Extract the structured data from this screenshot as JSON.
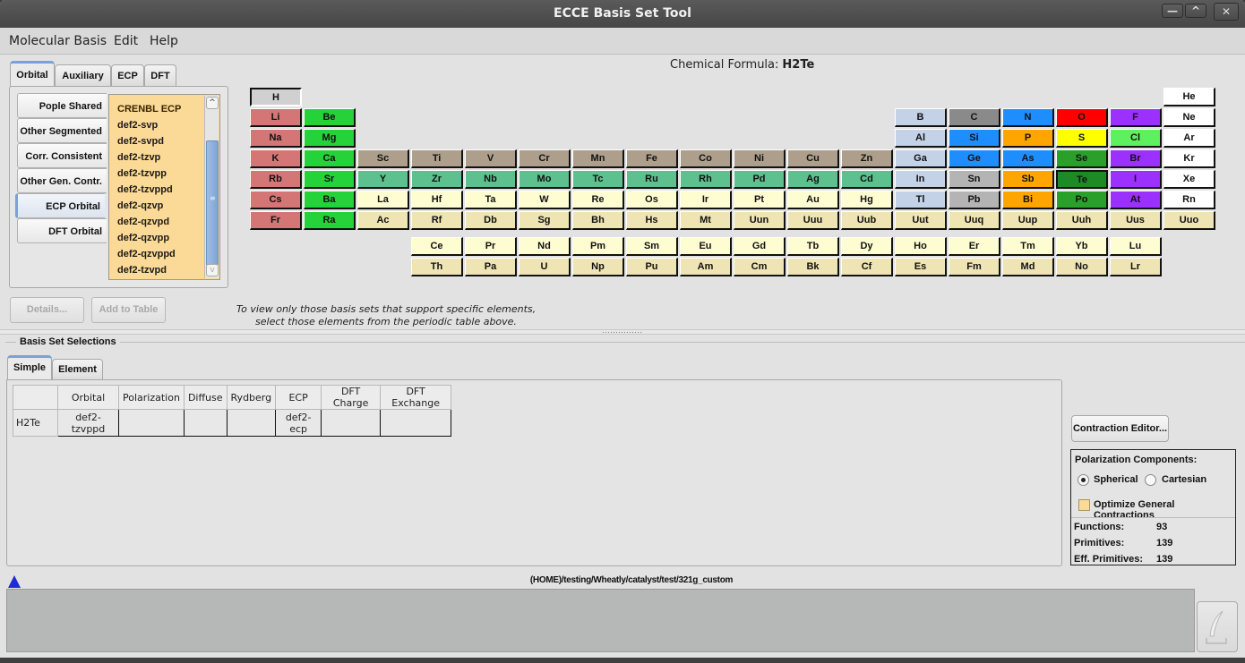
{
  "window": {
    "title": "ECCE Basis Set Tool",
    "controls": {
      "minimize": "—",
      "maximize": "^",
      "close": "✕"
    }
  },
  "menu": [
    "Molecular Basis",
    "Edit",
    "Help"
  ],
  "type_tabs": [
    {
      "label": "Orbital",
      "active": true
    },
    {
      "label": "Auxiliary",
      "active": false
    },
    {
      "label": "ECP",
      "active": false
    },
    {
      "label": "DFT",
      "active": false
    }
  ],
  "categories": [
    {
      "label": "Pople Shared",
      "active": false
    },
    {
      "label": "Other Segmented",
      "active": false
    },
    {
      "label": "Corr. Consistent",
      "active": false
    },
    {
      "label": "Other Gen. Contr.",
      "active": false
    },
    {
      "label": "ECP Orbital",
      "active": true
    },
    {
      "label": "DFT Orbital",
      "active": false
    }
  ],
  "basis_list": [
    "CRENBL ECP",
    "def2-svp",
    "def2-svpd",
    "def2-tzvp",
    "def2-tzvpp",
    "def2-tzvppd",
    "def2-qzvp",
    "def2-qzvpd",
    "def2-qzvpp",
    "def2-qzvppd",
    "def2-tzvpd"
  ],
  "scrollbar": {
    "up": "^",
    "down": "v",
    "grip": "≡"
  },
  "actions": {
    "details": "Details...",
    "add_to_table": "Add to Table"
  },
  "hint": {
    "line1": "To view only those basis sets that support specific elements,",
    "line2": "select those elements from the periodic table above."
  },
  "formula": {
    "label": "Chemical Formula:",
    "value": "H2Te"
  },
  "element_colors": {
    "alkali": "#d47676",
    "alkaline": "#26d23a",
    "tm4": "#ad9f8c",
    "tm5": "#5ec08f",
    "tm6": "#fefdd2",
    "tm7": "#eee4b4",
    "hydrogen": "#d0d0d0",
    "boron_grp": "#c3d2e6",
    "carbon": "#8a8a8a",
    "blue": "#1e8eff",
    "oxygen": "#ff0000",
    "halogen": "#9b30ff",
    "orange": "#ffa500",
    "sulfur": "#ffff00",
    "chlorine": "#5ef05e",
    "chalcogen": "#2aa02a",
    "tellurium": "#1e8a26",
    "noble": "#ffffff",
    "tin": "#b4b4b4"
  },
  "periodic_table": [
    {
      "s": "H",
      "r": 0,
      "c": 0,
      "k": "hydrogen",
      "sel": false
    },
    {
      "s": "He",
      "r": 0,
      "c": 17,
      "k": "noble"
    },
    {
      "s": "Li",
      "r": 1,
      "c": 0,
      "k": "alkali"
    },
    {
      "s": "Be",
      "r": 1,
      "c": 1,
      "k": "alkaline"
    },
    {
      "s": "B",
      "r": 1,
      "c": 12,
      "k": "boron_grp"
    },
    {
      "s": "C",
      "r": 1,
      "c": 13,
      "k": "carbon"
    },
    {
      "s": "N",
      "r": 1,
      "c": 14,
      "k": "blue"
    },
    {
      "s": "O",
      "r": 1,
      "c": 15,
      "k": "oxygen"
    },
    {
      "s": "F",
      "r": 1,
      "c": 16,
      "k": "halogen"
    },
    {
      "s": "Ne",
      "r": 1,
      "c": 17,
      "k": "noble"
    },
    {
      "s": "Na",
      "r": 2,
      "c": 0,
      "k": "alkali"
    },
    {
      "s": "Mg",
      "r": 2,
      "c": 1,
      "k": "alkaline"
    },
    {
      "s": "Al",
      "r": 2,
      "c": 12,
      "k": "boron_grp"
    },
    {
      "s": "Si",
      "r": 2,
      "c": 13,
      "k": "blue"
    },
    {
      "s": "P",
      "r": 2,
      "c": 14,
      "k": "orange"
    },
    {
      "s": "S",
      "r": 2,
      "c": 15,
      "k": "sulfur"
    },
    {
      "s": "Cl",
      "r": 2,
      "c": 16,
      "k": "chlorine"
    },
    {
      "s": "Ar",
      "r": 2,
      "c": 17,
      "k": "noble"
    },
    {
      "s": "K",
      "r": 3,
      "c": 0,
      "k": "alkali"
    },
    {
      "s": "Ca",
      "r": 3,
      "c": 1,
      "k": "alkaline"
    },
    {
      "s": "Sc",
      "r": 3,
      "c": 2,
      "k": "tm4"
    },
    {
      "s": "Ti",
      "r": 3,
      "c": 3,
      "k": "tm4"
    },
    {
      "s": "V",
      "r": 3,
      "c": 4,
      "k": "tm4"
    },
    {
      "s": "Cr",
      "r": 3,
      "c": 5,
      "k": "tm4"
    },
    {
      "s": "Mn",
      "r": 3,
      "c": 6,
      "k": "tm4"
    },
    {
      "s": "Fe",
      "r": 3,
      "c": 7,
      "k": "tm4"
    },
    {
      "s": "Co",
      "r": 3,
      "c": 8,
      "k": "tm4"
    },
    {
      "s": "Ni",
      "r": 3,
      "c": 9,
      "k": "tm4"
    },
    {
      "s": "Cu",
      "r": 3,
      "c": 10,
      "k": "tm4"
    },
    {
      "s": "Zn",
      "r": 3,
      "c": 11,
      "k": "tm4"
    },
    {
      "s": "Ga",
      "r": 3,
      "c": 12,
      "k": "boron_grp"
    },
    {
      "s": "Ge",
      "r": 3,
      "c": 13,
      "k": "blue"
    },
    {
      "s": "As",
      "r": 3,
      "c": 14,
      "k": "blue"
    },
    {
      "s": "Se",
      "r": 3,
      "c": 15,
      "k": "chalcogen"
    },
    {
      "s": "Br",
      "r": 3,
      "c": 16,
      "k": "halogen"
    },
    {
      "s": "Kr",
      "r": 3,
      "c": 17,
      "k": "noble"
    },
    {
      "s": "Rb",
      "r": 4,
      "c": 0,
      "k": "alkali"
    },
    {
      "s": "Sr",
      "r": 4,
      "c": 1,
      "k": "alkaline"
    },
    {
      "s": "Y",
      "r": 4,
      "c": 2,
      "k": "tm5"
    },
    {
      "s": "Zr",
      "r": 4,
      "c": 3,
      "k": "tm5"
    },
    {
      "s": "Nb",
      "r": 4,
      "c": 4,
      "k": "tm5"
    },
    {
      "s": "Mo",
      "r": 4,
      "c": 5,
      "k": "tm5"
    },
    {
      "s": "Tc",
      "r": 4,
      "c": 6,
      "k": "tm5"
    },
    {
      "s": "Ru",
      "r": 4,
      "c": 7,
      "k": "tm5"
    },
    {
      "s": "Rh",
      "r": 4,
      "c": 8,
      "k": "tm5"
    },
    {
      "s": "Pd",
      "r": 4,
      "c": 9,
      "k": "tm5"
    },
    {
      "s": "Ag",
      "r": 4,
      "c": 10,
      "k": "tm5"
    },
    {
      "s": "Cd",
      "r": 4,
      "c": 11,
      "k": "tm5"
    },
    {
      "s": "In",
      "r": 4,
      "c": 12,
      "k": "boron_grp"
    },
    {
      "s": "Sn",
      "r": 4,
      "c": 13,
      "k": "tin"
    },
    {
      "s": "Sb",
      "r": 4,
      "c": 14,
      "k": "orange"
    },
    {
      "s": "Te",
      "r": 4,
      "c": 15,
      "k": "tellurium",
      "sel": true
    },
    {
      "s": "I",
      "r": 4,
      "c": 16,
      "k": "halogen"
    },
    {
      "s": "Xe",
      "r": 4,
      "c": 17,
      "k": "noble"
    },
    {
      "s": "Cs",
      "r": 5,
      "c": 0,
      "k": "alkali"
    },
    {
      "s": "Ba",
      "r": 5,
      "c": 1,
      "k": "alkaline"
    },
    {
      "s": "La",
      "r": 5,
      "c": 2,
      "k": "tm6"
    },
    {
      "s": "Hf",
      "r": 5,
      "c": 3,
      "k": "tm6"
    },
    {
      "s": "Ta",
      "r": 5,
      "c": 4,
      "k": "tm6"
    },
    {
      "s": "W",
      "r": 5,
      "c": 5,
      "k": "tm6"
    },
    {
      "s": "Re",
      "r": 5,
      "c": 6,
      "k": "tm6"
    },
    {
      "s": "Os",
      "r": 5,
      "c": 7,
      "k": "tm6"
    },
    {
      "s": "Ir",
      "r": 5,
      "c": 8,
      "k": "tm6"
    },
    {
      "s": "Pt",
      "r": 5,
      "c": 9,
      "k": "tm6"
    },
    {
      "s": "Au",
      "r": 5,
      "c": 10,
      "k": "tm6"
    },
    {
      "s": "Hg",
      "r": 5,
      "c": 11,
      "k": "tm6"
    },
    {
      "s": "Tl",
      "r": 5,
      "c": 12,
      "k": "boron_grp"
    },
    {
      "s": "Pb",
      "r": 5,
      "c": 13,
      "k": "tin"
    },
    {
      "s": "Bi",
      "r": 5,
      "c": 14,
      "k": "orange"
    },
    {
      "s": "Po",
      "r": 5,
      "c": 15,
      "k": "chalcogen"
    },
    {
      "s": "At",
      "r": 5,
      "c": 16,
      "k": "halogen"
    },
    {
      "s": "Rn",
      "r": 5,
      "c": 17,
      "k": "noble"
    },
    {
      "s": "Fr",
      "r": 6,
      "c": 0,
      "k": "alkali"
    },
    {
      "s": "Ra",
      "r": 6,
      "c": 1,
      "k": "alkaline"
    },
    {
      "s": "Ac",
      "r": 6,
      "c": 2,
      "k": "tm7"
    },
    {
      "s": "Rf",
      "r": 6,
      "c": 3,
      "k": "tm7"
    },
    {
      "s": "Db",
      "r": 6,
      "c": 4,
      "k": "tm7"
    },
    {
      "s": "Sg",
      "r": 6,
      "c": 5,
      "k": "tm7"
    },
    {
      "s": "Bh",
      "r": 6,
      "c": 6,
      "k": "tm7"
    },
    {
      "s": "Hs",
      "r": 6,
      "c": 7,
      "k": "tm7"
    },
    {
      "s": "Mt",
      "r": 6,
      "c": 8,
      "k": "tm7"
    },
    {
      "s": "Uun",
      "r": 6,
      "c": 9,
      "k": "tm7"
    },
    {
      "s": "Uuu",
      "r": 6,
      "c": 10,
      "k": "tm7"
    },
    {
      "s": "Uub",
      "r": 6,
      "c": 11,
      "k": "tm7"
    },
    {
      "s": "Uut",
      "r": 6,
      "c": 12,
      "k": "tm7"
    },
    {
      "s": "Uuq",
      "r": 6,
      "c": 13,
      "k": "tm7"
    },
    {
      "s": "Uup",
      "r": 6,
      "c": 14,
      "k": "tm7"
    },
    {
      "s": "Uuh",
      "r": 6,
      "c": 15,
      "k": "tm7"
    },
    {
      "s": "Uus",
      "r": 6,
      "c": 16,
      "k": "tm7"
    },
    {
      "s": "Uuo",
      "r": 6,
      "c": 17,
      "k": "tm7"
    },
    {
      "s": "Ce",
      "r": 7,
      "c": 3,
      "k": "tm6"
    },
    {
      "s": "Pr",
      "r": 7,
      "c": 4,
      "k": "tm6"
    },
    {
      "s": "Nd",
      "r": 7,
      "c": 5,
      "k": "tm6"
    },
    {
      "s": "Pm",
      "r": 7,
      "c": 6,
      "k": "tm6"
    },
    {
      "s": "Sm",
      "r": 7,
      "c": 7,
      "k": "tm6"
    },
    {
      "s": "Eu",
      "r": 7,
      "c": 8,
      "k": "tm6"
    },
    {
      "s": "Gd",
      "r": 7,
      "c": 9,
      "k": "tm6"
    },
    {
      "s": "Tb",
      "r": 7,
      "c": 10,
      "k": "tm6"
    },
    {
      "s": "Dy",
      "r": 7,
      "c": 11,
      "k": "tm6"
    },
    {
      "s": "Ho",
      "r": 7,
      "c": 12,
      "k": "tm6"
    },
    {
      "s": "Er",
      "r": 7,
      "c": 13,
      "k": "tm6"
    },
    {
      "s": "Tm",
      "r": 7,
      "c": 14,
      "k": "tm6"
    },
    {
      "s": "Yb",
      "r": 7,
      "c": 15,
      "k": "tm6"
    },
    {
      "s": "Lu",
      "r": 7,
      "c": 16,
      "k": "tm6"
    },
    {
      "s": "Th",
      "r": 8,
      "c": 3,
      "k": "tm7"
    },
    {
      "s": "Pa",
      "r": 8,
      "c": 4,
      "k": "tm7"
    },
    {
      "s": "U",
      "r": 8,
      "c": 5,
      "k": "tm7"
    },
    {
      "s": "Np",
      "r": 8,
      "c": 6,
      "k": "tm7"
    },
    {
      "s": "Pu",
      "r": 8,
      "c": 7,
      "k": "tm7"
    },
    {
      "s": "Am",
      "r": 8,
      "c": 8,
      "k": "tm7"
    },
    {
      "s": "Cm",
      "r": 8,
      "c": 9,
      "k": "tm7"
    },
    {
      "s": "Bk",
      "r": 8,
      "c": 10,
      "k": "tm7"
    },
    {
      "s": "Cf",
      "r": 8,
      "c": 11,
      "k": "tm7"
    },
    {
      "s": "Es",
      "r": 8,
      "c": 12,
      "k": "tm7"
    },
    {
      "s": "Fm",
      "r": 8,
      "c": 13,
      "k": "tm7"
    },
    {
      "s": "Md",
      "r": 8,
      "c": 14,
      "k": "tm7"
    },
    {
      "s": "No",
      "r": 8,
      "c": 15,
      "k": "tm7"
    },
    {
      "s": "Lr",
      "r": 8,
      "c": 16,
      "k": "tm7"
    }
  ],
  "selections": {
    "label": "Basis Set Selections",
    "tabs": [
      {
        "label": "Simple",
        "active": true
      },
      {
        "label": "Element",
        "active": false
      }
    ],
    "columns": [
      "",
      "Orbital",
      "Polarization",
      "Diffuse",
      "Rydberg",
      "ECP",
      "DFT Charge",
      "DFT Exchange"
    ],
    "rows": [
      [
        "H2Te",
        "def2-tzvppd",
        "",
        "",
        "",
        "def2-ecp",
        "",
        ""
      ]
    ]
  },
  "contraction_editor": "Contraction Editor...",
  "polarization": {
    "title": "Polarization Components:",
    "options": [
      {
        "label": "Spherical",
        "selected": true
      },
      {
        "label": "Cartesian",
        "selected": false
      }
    ],
    "optimize_label": "Optimize General Contractions",
    "optimize_checked": false
  },
  "stats": [
    {
      "label": "Functions:",
      "value": "93"
    },
    {
      "label": "Primitives:",
      "value": "139"
    },
    {
      "label": "Eff. Primitives:",
      "value": "139"
    }
  ],
  "status": {
    "path": "(HOME)/testing/Wheatly/catalyst/test/321g_custom"
  }
}
